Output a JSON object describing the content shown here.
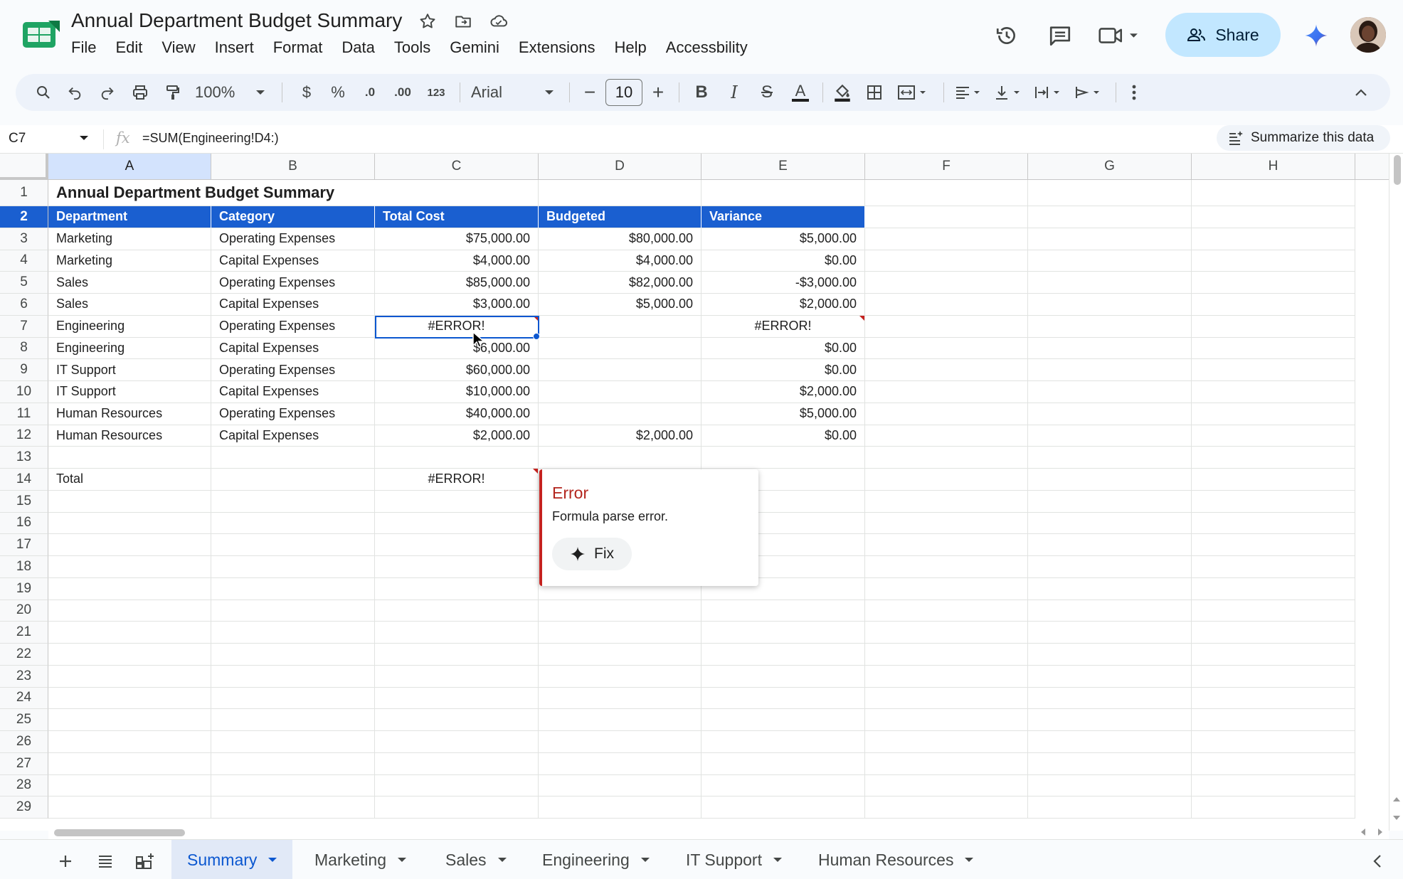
{
  "app": {
    "doc_title": "Annual Department Budget Summary",
    "menu": [
      "File",
      "Edit",
      "View",
      "Insert",
      "Format",
      "Data",
      "Tools",
      "Gemini",
      "Extensions",
      "Help",
      "Accessbility"
    ],
    "share_label": "Share"
  },
  "toolbar": {
    "zoom": "100%",
    "currency": "$",
    "percent": "%",
    "dec_decrease": ".0",
    "dec_increase": ".00",
    "number_format": "123",
    "font": "Arial",
    "font_size": "10"
  },
  "formula_bar": {
    "cell_ref": "C7",
    "fx": "fx",
    "formula": "=SUM(Engineering!D4:)",
    "summarize_label": "Summarize this data"
  },
  "grid": {
    "columns": [
      "A",
      "B",
      "C",
      "D",
      "E",
      "F",
      "G",
      "H"
    ],
    "rows": [
      "1",
      "2",
      "3",
      "4",
      "5",
      "6",
      "7",
      "8",
      "9",
      "10",
      "11",
      "12",
      "13",
      "14",
      "15",
      "16",
      "17",
      "18",
      "19",
      "20",
      "21",
      "22",
      "23",
      "24",
      "25",
      "26",
      "27",
      "28",
      "29"
    ],
    "title": "Annual Department Budget Summary",
    "headers": [
      "Department",
      "Category",
      "Total Cost",
      "Budgeted",
      "Variance"
    ],
    "data": [
      [
        "Marketing",
        "Operating Expenses",
        "$75,000.00",
        "$80,000.00",
        "$5,000.00"
      ],
      [
        "Marketing",
        "Capital Expenses",
        "$4,000.00",
        "$4,000.00",
        "$0.00"
      ],
      [
        "Sales",
        "Operating Expenses",
        "$85,000.00",
        "$82,000.00",
        "-$3,000.00"
      ],
      [
        "Sales",
        "Capital Expenses",
        "$3,000.00",
        "$5,000.00",
        "$2,000.00"
      ],
      [
        "Engineering",
        "Operating Expenses",
        "#ERROR!",
        "",
        "#ERROR!"
      ],
      [
        "Engineering",
        "Capital Expenses",
        "$6,000.00",
        "",
        "$0.00"
      ],
      [
        "IT Support",
        "Operating Expenses",
        "$60,000.00",
        "",
        "$0.00"
      ],
      [
        "IT Support",
        "Capital Expenses",
        "$10,000.00",
        "",
        "$2,000.00"
      ],
      [
        "Human Resources",
        "Operating Expenses",
        "$40,000.00",
        "",
        "$5,000.00"
      ],
      [
        "Human Resources",
        "Capital Expenses",
        "$2,000.00",
        "$2,000.00",
        "$0.00"
      ]
    ],
    "total_label": "Total",
    "total_value": "#ERROR!"
  },
  "error_popup": {
    "title": "Error",
    "message": "Formula parse error.",
    "fix_label": "Fix"
  },
  "sheets": [
    "Summary",
    "Marketing",
    "Sales",
    "Engineering",
    "IT Support",
    "Human Resources"
  ],
  "colors": {
    "header_fill": "#1a5fd0",
    "selection": "#0b57d0",
    "error": "#b3261e",
    "share_bg": "#c2e7ff"
  }
}
